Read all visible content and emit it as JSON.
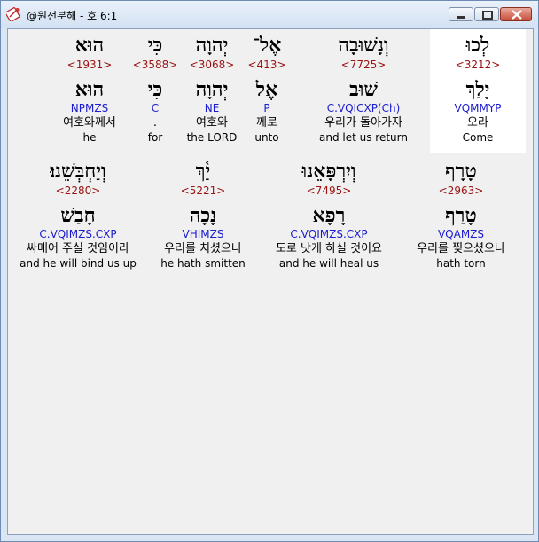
{
  "window": {
    "title": "@원전분해 - 호 6:1",
    "icons": {
      "app": "bible-app-icon",
      "minimize": "minimize-icon",
      "maximize": "maximize-icon",
      "close": "close-icon"
    }
  },
  "colors": {
    "strong": "#9a1212",
    "morph": "#1a1ad0",
    "selected_bg": "#ffffff"
  },
  "rows": [
    {
      "words": [
        {
          "hebrew": "לְכוּ",
          "strong": "<3212>",
          "root": "יָלַךְ",
          "morph": "VQMMYP",
          "korean": "오라",
          "english": "Come",
          "selected": true
        },
        {
          "hebrew": "וְנָשׁוּבָה",
          "strong": "<7725>",
          "root": "שׁוּב",
          "morph": "C.VQICXP(Ch)",
          "korean": "우리가 돌아가자",
          "english": "and let us return",
          "selected": false
        },
        {
          "hebrew": "אֶל־",
          "strong": "<413>",
          "root": "אֶל",
          "morph": "P",
          "korean": "께로",
          "english": "unto",
          "selected": false
        },
        {
          "hebrew": "יְהוָה",
          "strong": "<3068>",
          "root": "יְהוָה",
          "morph": "NE",
          "korean": "여호와",
          "english": "the LORD",
          "selected": false
        },
        {
          "hebrew": "כִּי",
          "strong": "<3588>",
          "root": "כִּי",
          "morph": "C",
          "korean": ".",
          "english": "for",
          "selected": false
        },
        {
          "hebrew": "הוּא",
          "strong": "<1931>",
          "root": "הוּא",
          "morph": "NPMZS",
          "korean": "여호와께서",
          "english": "he",
          "selected": false
        }
      ]
    },
    {
      "words": [
        {
          "hebrew": "טָרָף",
          "strong": "<2963>",
          "root": "טָרַף",
          "morph": "VQAMZS",
          "korean": "우리를 찢으셨으나",
          "english": "hath torn",
          "selected": false
        },
        {
          "hebrew": "וְיִרְפָּאֵנוּ",
          "strong": "<7495>",
          "root": "רָפָא",
          "morph": "C.VQIMZS.CXP",
          "korean": "도로 낫게 하실 것이요",
          "english": "and he will heal us",
          "selected": false
        },
        {
          "hebrew": "יַ֫ךְ",
          "strong": "<5221>",
          "root": "נָכָה",
          "morph": "VHIMZS",
          "korean": "우리를 치셨으나",
          "english": "he hath smitten",
          "selected": false
        },
        {
          "hebrew": "וְיַחְבְּשֵׁנוּ׃",
          "strong": "<2280>",
          "root": "חָבַשׁ",
          "morph": "C.VQIMZS.CXP",
          "korean": "싸매어 주실 것임이라",
          "english": "and he will bind us up",
          "selected": false
        }
      ]
    }
  ]
}
